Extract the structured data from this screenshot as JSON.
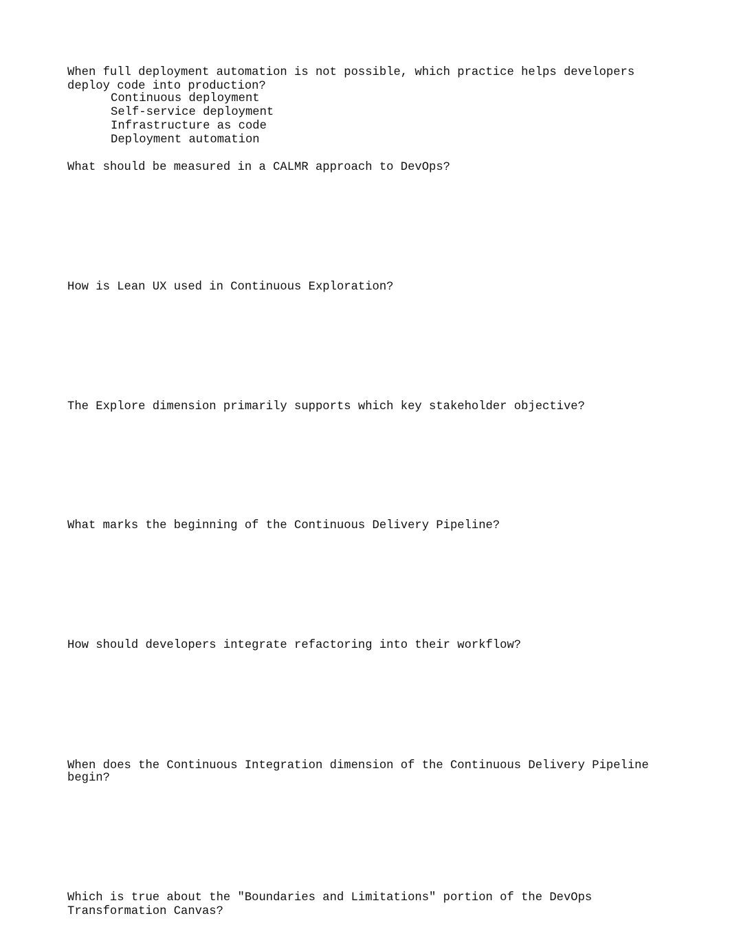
{
  "questions": [
    {
      "lines": [
        "When full deployment automation is not possible, which practice helps developers",
        "deploy code into production?"
      ],
      "options": [
        "Continuous deployment",
        "Self-service deployment",
        "Infrastructure as code",
        "Deployment automation"
      ]
    },
    {
      "lines": [
        "What should be measured in a CALMR approach to DevOps?"
      ]
    },
    {
      "lines": [
        "How is Lean UX used in Continuous Exploration?"
      ]
    },
    {
      "lines": [
        "The Explore dimension primarily supports which key stakeholder objective?"
      ]
    },
    {
      "lines": [
        "What marks the beginning of the Continuous Delivery Pipeline?"
      ]
    },
    {
      "lines": [
        "How should developers integrate refactoring into their workflow?"
      ]
    },
    {
      "lines": [
        "When does the Continuous Integration dimension of the Continuous Delivery Pipeline",
        "begin?"
      ]
    },
    {
      "lines": [
        "Which is true about the \"Boundaries and Limitations\" portion of the DevOps",
        "Transformation Canvas?"
      ]
    }
  ]
}
